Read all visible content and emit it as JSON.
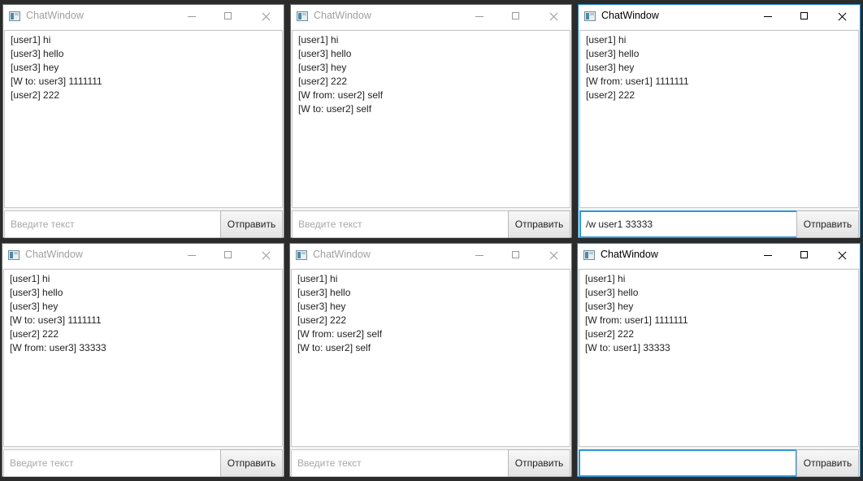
{
  "input_placeholder": "Введите текст",
  "send_label": "Отправить",
  "windows": [
    {
      "title": "ChatWindow",
      "messages": [
        "[user1] hi",
        "[user3] hello",
        "[user3] hey",
        "[W to: user3] 1111111",
        "[user2] 222"
      ],
      "input_value": ""
    },
    {
      "title": "ChatWindow",
      "messages": [
        "[user1] hi",
        "[user3] hello",
        "[user3] hey",
        "[user2] 222",
        "[W from: user2] self",
        "[W to: user2] self"
      ],
      "input_value": ""
    },
    {
      "title": "ChatWindow",
      "messages": [
        "[user1] hi",
        "[user3] hello",
        "[user3] hey",
        "[W from: user1] 1111111",
        "[user2] 222"
      ],
      "input_value": "/w user1 33333"
    },
    {
      "title": "ChatWindow",
      "messages": [
        "[user1] hi",
        "[user3] hello",
        "[user3] hey",
        "[W to: user3] 1111111",
        "[user2] 222",
        "[W from: user3] 33333"
      ],
      "input_value": ""
    },
    {
      "title": "ChatWindow",
      "messages": [
        "[user1] hi",
        "[user3] hello",
        "[user3] hey",
        "[user2] 222",
        "[W from: user2] self",
        "[W to: user2] self"
      ],
      "input_value": ""
    },
    {
      "title": "ChatWindow",
      "messages": [
        "[user1] hi",
        "[user3] hello",
        "[user3] hey",
        "[W from: user1] 1111111",
        "[user2] 222",
        "[W to: user1] 33333"
      ],
      "input_value": ""
    }
  ]
}
